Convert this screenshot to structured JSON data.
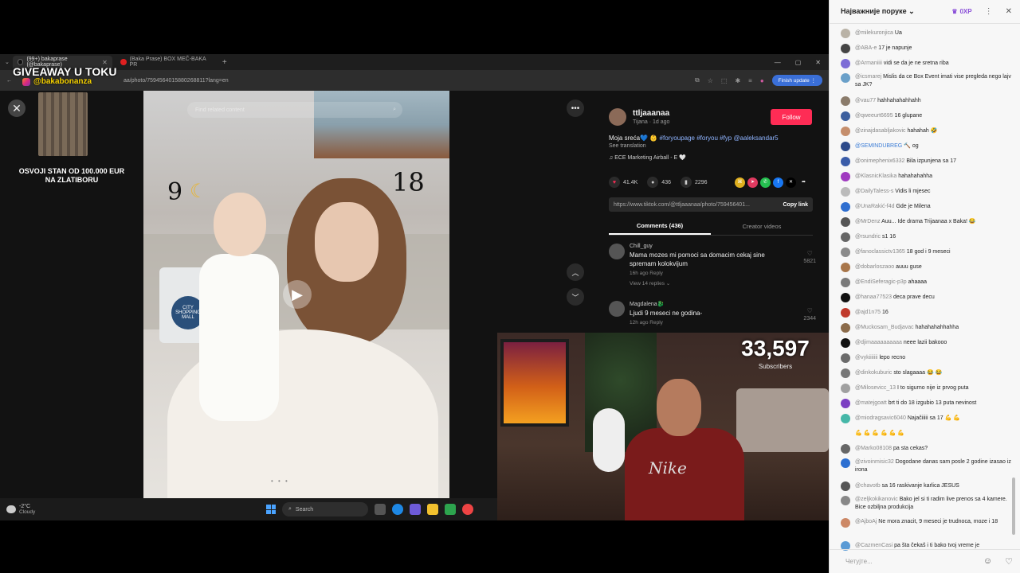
{
  "browser": {
    "tabs": [
      {
        "label": "(99+) bakaprase (@bakaprase)",
        "active": true
      },
      {
        "label": "(Baka Prase) BOX MEČ-BAKA PR",
        "active": false
      }
    ],
    "url": "aa/photo/7594564015880268811?lang=en",
    "finish_update": "Finish update"
  },
  "overlay": {
    "giveaway": "GIVEAWAY U TOKU",
    "handle": "@bakabonanza",
    "promo_line1": "OSVOJI STAN OD 100.000 EUR",
    "promo_line2": "NA ZLATIBORU"
  },
  "photo": {
    "search_placeholder": "Find related content",
    "num_left": "9",
    "num_right": "18",
    "bag_logo": "CITY SHOPPING MALL",
    "dots": "• • •"
  },
  "post": {
    "author": "ttljaaanaa",
    "author_sub": "Tijana · 1d ago",
    "follow": "Follow",
    "caption_text": "Moja sreća💙 👶",
    "caption_tags": "#foryoupage #foryou #fyp @aaleksandar5",
    "see_translation": "See translation",
    "music": "♫  ECE Marketing Airball - E 🤍",
    "likes": "41.4K",
    "comments": "436",
    "saves": "2296",
    "link": "https://www.tiktok.com/@ttljaaanaa/photo/759456401...",
    "copy_link": "Copy link",
    "tab_comments": "Comments (436)",
    "tab_creator": "Creator videos",
    "comment_list": [
      {
        "name": "Chill_guy",
        "text": "Mama mozes mi pomoci sa domacim cekaj sine spremam kolokvijum",
        "meta": "16h ago     Reply",
        "replies": "View 14 replies ⌄",
        "likes": "5821"
      },
      {
        "name": "Magdalena🐉",
        "text": "Ljudi 9 meseci ne godina-",
        "meta": "12h ago     Reply",
        "replies": "",
        "likes": "2344"
      }
    ]
  },
  "stream": {
    "subs_count": "33,597",
    "subs_label": "Subscribers",
    "shirt_logo": "Nike"
  },
  "taskbar": {
    "temp": "-2°C",
    "condition": "Cloudy",
    "search": "Search"
  },
  "chat": {
    "header_select": "Најважније поруке",
    "xp": "0XP",
    "input_placeholder": "Четујте...",
    "messages": [
      {
        "name": "@milekuronjica",
        "text": "Ua",
        "color": "#b9b2a6"
      },
      {
        "name": "@ABA-e",
        "text": "17 je napunje",
        "color": "#444"
      },
      {
        "name": "@Armaniiii",
        "text": "vidi se da je ne sretna riba",
        "color": "#7c6cd6"
      },
      {
        "name": "@icsmarej",
        "text": "Mislis da ce Box Event imati vise pregleda nego lajv sa JK?",
        "color": "#6aa0c9",
        "two": true
      },
      {
        "name": "@vau77",
        "text": "hahhahahahhahh",
        "color": "#8a7b6b"
      },
      {
        "name": "@qweeurt6695",
        "text": "16 glupane",
        "color": "#3c5f9e"
      },
      {
        "name": "@zinajdasabljakovic",
        "text": "hahahah 🤣",
        "color": "#c58e6c"
      },
      {
        "name": "@SEMINDUBREG",
        "text": "🔨 og",
        "color": "#2d4a8a",
        "blue": true
      },
      {
        "name": "@onimephenix6332",
        "text": "Bila izpunjena sa 17",
        "color": "#3a5ca8"
      },
      {
        "name": "@KlasnicKlasika",
        "text": "hahahahahha",
        "color": "#a03ac0"
      },
      {
        "name": "@DailyTaless-s",
        "text": "Vidis li mjeseс",
        "color": "#bbb"
      },
      {
        "name": "@UnaRakić-f4d",
        "text": "Gde je Milena",
        "color": "#2f6fd0"
      },
      {
        "name": "@MrDenz",
        "text": "Auu... Ide drama Trijaanaa x Baka! 😂",
        "color": "#555"
      },
      {
        "name": "@rsundric",
        "text": "s1 16",
        "color": "#666"
      },
      {
        "name": "@fanoclassictv1365",
        "text": "18 god i 9 meseci",
        "color": "#8a8a8a"
      },
      {
        "name": "@dobarloszaoo",
        "text": "auuu guse",
        "color": "#a8764a"
      },
      {
        "name": "@EndiSeferagic-p3p",
        "text": "ahaaaa",
        "color": "#7a7a7a"
      },
      {
        "name": "@hanaa77523",
        "text": "deca prave decu",
        "color": "#111"
      },
      {
        "name": "@ajd1n75",
        "text": "16",
        "color": "#c0392b"
      },
      {
        "name": "@Muckosam_Budjavac",
        "text": "hahahahahhahha",
        "color": "#8b6b4a"
      },
      {
        "name": "@djimaaaaaaaaaa",
        "text": "neee lazii bakooo",
        "color": "#111"
      },
      {
        "name": "@vykiiiiiii",
        "text": "lepo recno",
        "color": "#6b6b6b"
      },
      {
        "name": "@dinkokuburic",
        "text": "sto slagaaaa 😂 😂",
        "color": "#777"
      },
      {
        "name": "@Milosevicc_13",
        "text": "I to sigurno nije iz prvog puta",
        "color": "#a0a0a0"
      },
      {
        "name": "@matejgoatt",
        "text": "brt ti do 18 izgubio 13 puta nevinost",
        "color": "#7b3fc2"
      },
      {
        "name": "@miodragsavic6040",
        "text": "Najačiiiii sa 17 💪 💪",
        "color": "#45b7a8"
      },
      {
        "name": "",
        "text": "💪 💪 💪 💪 💪 💪",
        "color": "",
        "noav": true
      },
      {
        "name": "@Marko08108",
        "text": "pa sta cekas?",
        "color": "#666"
      },
      {
        "name": "@zivoinmisic32",
        "text": "Dogodane danas sam posle 2 godine izasao iz irona",
        "color": "#2c6fd1",
        "two": true
      },
      {
        "name": "@chavotb",
        "text": "sa 16 raskivanje karlica JESUS",
        "color": "#555"
      },
      {
        "name": "@zeljkokikanovic",
        "text": "Bako jel si ti radim live prenos sa 4 kamere. Bice ozbiljna produkcija",
        "color": "#888",
        "two": true
      },
      {
        "name": "@AjboAj",
        "text": "Ne mora znacit, 9 meseci je trudnoca, moze i 18",
        "color": "#c86",
        "two": true
      },
      {
        "name": "@CazmenCasi",
        "text": "pa šta čekaš i ti bako tvoj vreme je",
        "color": "#5b9bd5"
      }
    ]
  }
}
